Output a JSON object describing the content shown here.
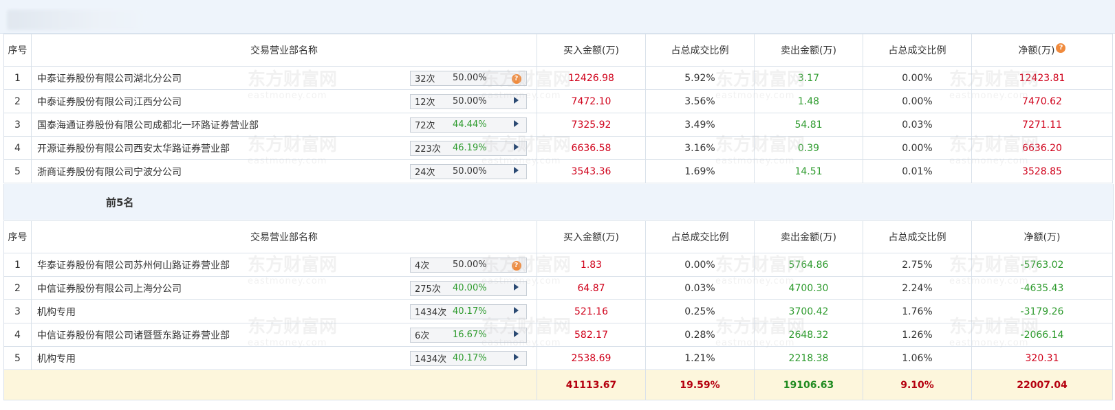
{
  "headers": {
    "index": "序号",
    "branch": "交易营业部名称",
    "buy_amount": "买入金额(万)",
    "buy_ratio": "占总成交比例",
    "sell_amount": "卖出金额(万)",
    "sell_ratio": "占总成交比例",
    "net": "净额(万)"
  },
  "section_label": "前5名",
  "buy_rows": [
    {
      "idx": "1",
      "name": "中泰证券股份有限公司湖北分公司",
      "times": "32次",
      "pct": "50.00%",
      "pct_color": "blk",
      "icon": "help-icon",
      "buy": "12426.98",
      "buy_ratio": "5.92%",
      "sell": "3.17",
      "sell_ratio": "0.00%",
      "net": "12423.81",
      "net_color": "red"
    },
    {
      "idx": "2",
      "name": "中泰证券股份有限公司江西分公司",
      "times": "12次",
      "pct": "50.00%",
      "pct_color": "blk",
      "icon": "arrow-right-icon",
      "buy": "7472.10",
      "buy_ratio": "3.56%",
      "sell": "1.48",
      "sell_ratio": "0.00%",
      "net": "7470.62",
      "net_color": "red"
    },
    {
      "idx": "3",
      "name": "国泰海通证券股份有限公司成都北一环路证券营业部",
      "times": "72次",
      "pct": "44.44%",
      "pct_color": "green",
      "icon": "arrow-right-icon",
      "buy": "7325.92",
      "buy_ratio": "3.49%",
      "sell": "54.81",
      "sell_ratio": "0.03%",
      "net": "7271.11",
      "net_color": "red"
    },
    {
      "idx": "4",
      "name": "开源证券股份有限公司西安太华路证券营业部",
      "times": "223次",
      "pct": "46.19%",
      "pct_color": "green",
      "icon": "arrow-right-icon",
      "buy": "6636.58",
      "buy_ratio": "3.16%",
      "sell": "0.39",
      "sell_ratio": "0.00%",
      "net": "6636.20",
      "net_color": "red"
    },
    {
      "idx": "5",
      "name": "浙商证券股份有限公司宁波分公司",
      "times": "24次",
      "pct": "50.00%",
      "pct_color": "blk",
      "icon": "arrow-right-icon",
      "buy": "3543.36",
      "buy_ratio": "1.69%",
      "sell": "14.51",
      "sell_ratio": "0.01%",
      "net": "3528.85",
      "net_color": "red"
    }
  ],
  "sell_rows": [
    {
      "idx": "1",
      "name": "华泰证券股份有限公司苏州何山路证券营业部",
      "times": "4次",
      "pct": "50.00%",
      "pct_color": "blk",
      "icon": "help-icon",
      "buy": "1.83",
      "buy_ratio": "0.00%",
      "sell": "5764.86",
      "sell_ratio": "2.75%",
      "net": "-5763.02",
      "net_color": "green"
    },
    {
      "idx": "2",
      "name": "中信证券股份有限公司上海分公司",
      "times": "275次",
      "pct": "40.00%",
      "pct_color": "green",
      "icon": "arrow-right-icon",
      "buy": "64.87",
      "buy_ratio": "0.03%",
      "sell": "4700.30",
      "sell_ratio": "2.24%",
      "net": "-4635.43",
      "net_color": "green"
    },
    {
      "idx": "3",
      "name": "机构专用",
      "times": "1434次",
      "pct": "40.17%",
      "pct_color": "green",
      "icon": "arrow-right-icon",
      "buy": "521.16",
      "buy_ratio": "0.25%",
      "sell": "3700.42",
      "sell_ratio": "1.76%",
      "net": "-3179.26",
      "net_color": "green"
    },
    {
      "idx": "4",
      "name": "中信证券股份有限公司诸暨暨东路证券营业部",
      "times": "6次",
      "pct": "16.67%",
      "pct_color": "green",
      "icon": "arrow-right-icon",
      "buy": "582.17",
      "buy_ratio": "0.28%",
      "sell": "2648.32",
      "sell_ratio": "1.26%",
      "net": "-2066.14",
      "net_color": "green"
    },
    {
      "idx": "5",
      "name": "机构专用",
      "times": "1434次",
      "pct": "40.17%",
      "pct_color": "green",
      "icon": "arrow-right-icon",
      "buy": "2538.69",
      "buy_ratio": "1.21%",
      "sell": "2218.38",
      "sell_ratio": "1.06%",
      "net": "320.31",
      "net_color": "red"
    }
  ],
  "totals": {
    "buy": "41113.67",
    "buy_ratio": "19.59%",
    "sell": "19106.63",
    "sell_ratio": "9.10%",
    "net": "22007.04"
  },
  "watermark": {
    "cn": "东方财富网",
    "en": "eastmoney.com"
  },
  "colors": {
    "positive": "#d0021b",
    "negative": "#2e9b2e",
    "header_bg": "#eef4fb",
    "total_bg": "#fdf6dc",
    "help_icon": "#f08a3c"
  }
}
